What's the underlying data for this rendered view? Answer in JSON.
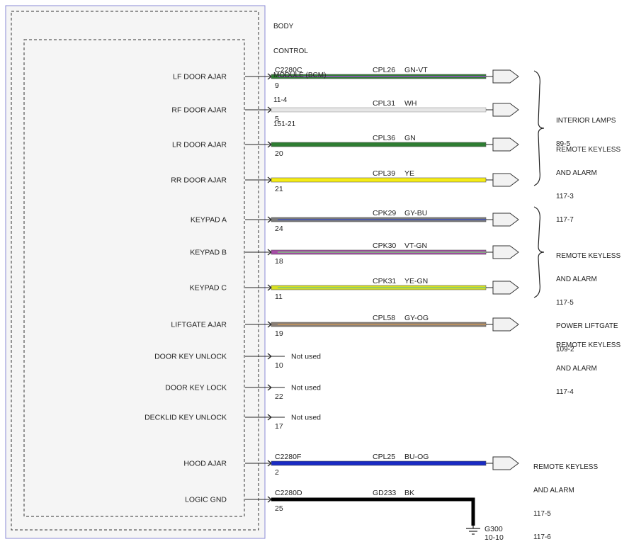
{
  "module": {
    "name_lines": [
      "BODY",
      "CONTROL",
      "MODULE (BCM)"
    ],
    "refs": [
      "11-4",
      "151-21"
    ]
  },
  "pins": [
    {
      "label": "LF DOOR AJAR",
      "pin": "9",
      "connector": "C2280C",
      "circuit": "CPL26",
      "color_code": "GN-VT",
      "wire_color": "#2e7d32",
      "stripe_color": "#9c4dcc",
      "used": true
    },
    {
      "label": "RF DOOR AJAR",
      "pin": "5",
      "connector": "",
      "circuit": "CPL31",
      "color_code": "WH",
      "wire_color": "#e6e6e6",
      "stripe_color": "#e6e6e6",
      "used": true
    },
    {
      "label": "LR DOOR AJAR",
      "pin": "20",
      "connector": "",
      "circuit": "CPL36",
      "color_code": "GN",
      "wire_color": "#2e7d32",
      "stripe_color": "#2e7d32",
      "used": true
    },
    {
      "label": "RR DOOR AJAR",
      "pin": "21",
      "connector": "",
      "circuit": "CPL39",
      "color_code": "YE",
      "wire_color": "#f5ec16",
      "stripe_color": "#f5ec16",
      "used": true
    },
    {
      "label": "KEYPAD A",
      "pin": "24",
      "connector": "",
      "circuit": "CPK29",
      "color_code": "GY-BU",
      "wire_color": "#7a7a7a",
      "stripe_color": "#3f51b5",
      "used": true
    },
    {
      "label": "KEYPAD B",
      "pin": "18",
      "connector": "",
      "circuit": "CPK30",
      "color_code": "VT-GN",
      "wire_color": "#a64ca6",
      "stripe_color": "#7dc47d",
      "used": true
    },
    {
      "label": "KEYPAD C",
      "pin": "11",
      "connector": "",
      "circuit": "CPK31",
      "color_code": "YE-GN",
      "wire_color": "#d8e020",
      "stripe_color": "#7dc47d",
      "used": true
    },
    {
      "label": "LIFTGATE AJAR",
      "pin": "19",
      "connector": "",
      "circuit": "CPL58",
      "color_code": "GY-OG",
      "wire_color": "#8a7e74",
      "stripe_color": "#c8955a",
      "used": true
    },
    {
      "label": "DOOR KEY UNLOCK",
      "pin": "10",
      "connector": "",
      "circuit": "",
      "color_code": "",
      "note": "Not used",
      "used": false
    },
    {
      "label": "DOOR KEY LOCK",
      "pin": "22",
      "connector": "",
      "circuit": "",
      "color_code": "",
      "note": "Not used",
      "used": false
    },
    {
      "label": "DECKLID KEY UNLOCK",
      "pin": "17",
      "connector": "",
      "circuit": "",
      "color_code": "",
      "note": "Not used",
      "used": false
    },
    {
      "label": "HOOD AJAR",
      "pin": "2",
      "connector": "C2280F",
      "circuit": "CPL25",
      "color_code": "BU-OG",
      "wire_color": "#1a2bc4",
      "stripe_color": "#1a2bc4",
      "used": true
    },
    {
      "label": "LOGIC GND",
      "pin": "25",
      "connector": "C2280D",
      "circuit": "GD233",
      "color_code": "BK",
      "wire_color": "#000000",
      "stripe_color": "#000000",
      "used": true,
      "ground": true
    }
  ],
  "destinations": [
    {
      "lines": [
        "INTERIOR LAMPS",
        "89-5"
      ]
    },
    {
      "lines": [
        "REMOTE KEYLESS",
        "AND ALARM",
        "117-3",
        "117-7"
      ]
    },
    {
      "lines": [
        "REMOTE KEYLESS",
        "AND ALARM",
        "117-5"
      ]
    },
    {
      "lines": [
        "POWER LIFTGATE",
        "109-2"
      ]
    },
    {
      "lines": [
        "REMOTE KEYLESS",
        "AND ALARM",
        "117-4"
      ]
    },
    {
      "lines": [
        "REMOTE KEYLESS",
        "AND ALARM",
        "117-5",
        "117-6"
      ]
    }
  ],
  "ground": {
    "name": "G300",
    "ref": "10-10"
  }
}
